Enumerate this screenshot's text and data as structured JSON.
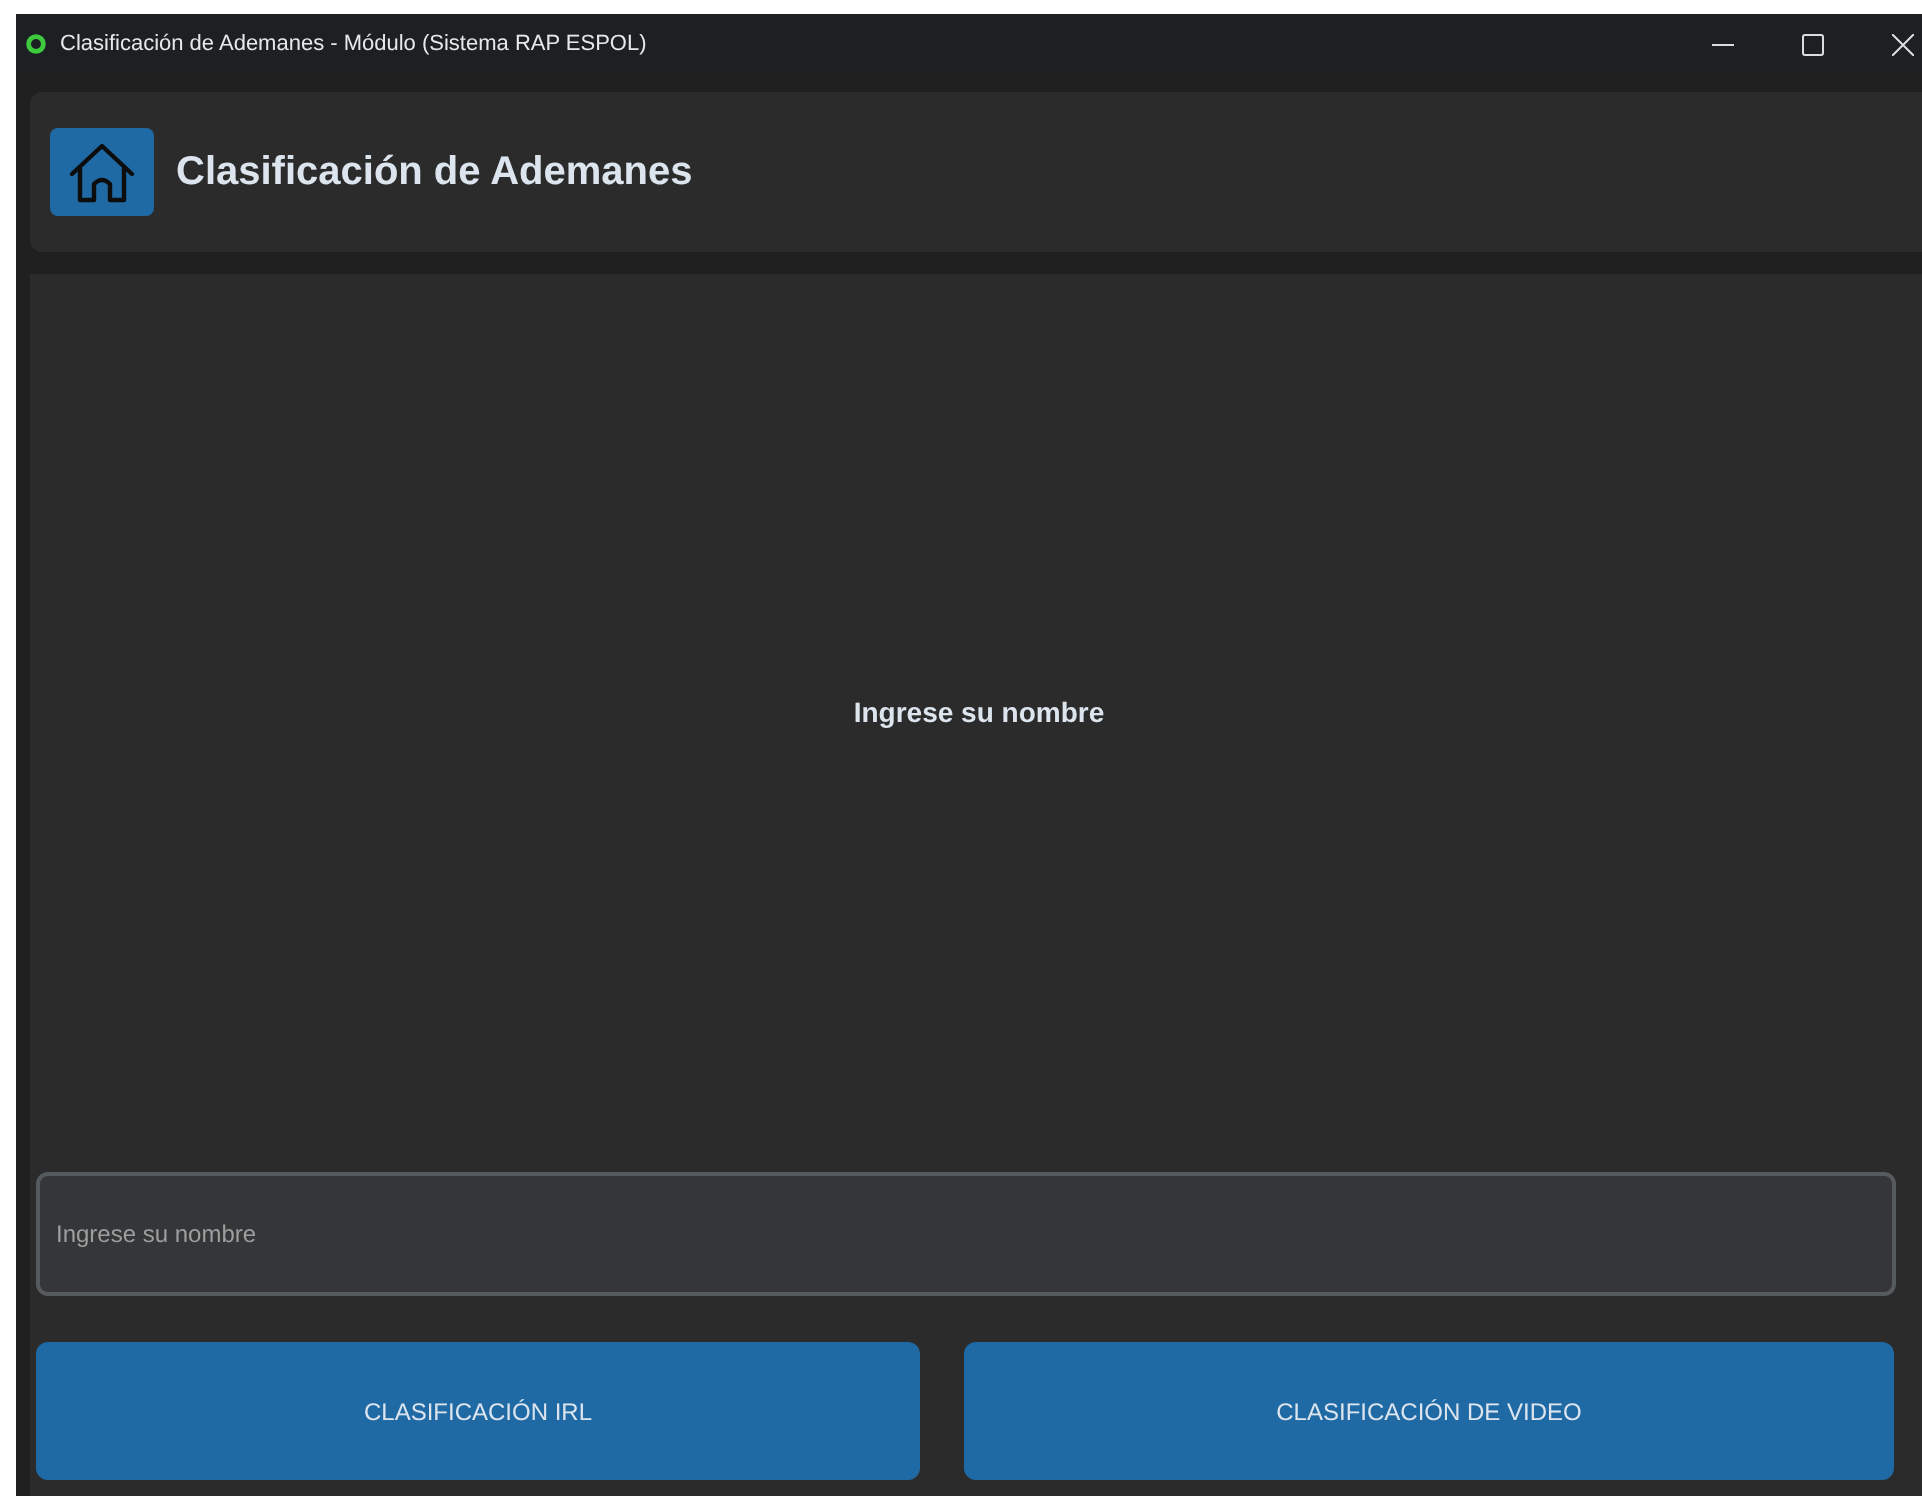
{
  "window": {
    "title": "Clasificación de Ademanes - Módulo (Sistema RAP ESPOL)"
  },
  "header": {
    "title": "Clasificación de Ademanes"
  },
  "prompt": "Ingrese su nombre",
  "name_field": {
    "placeholder": "Ingrese su nombre"
  },
  "buttons": [
    {
      "label": "CLASIFICACIÓN IRL"
    },
    {
      "label": "CLASIFICACIÓN DE VIDEO"
    }
  ]
}
